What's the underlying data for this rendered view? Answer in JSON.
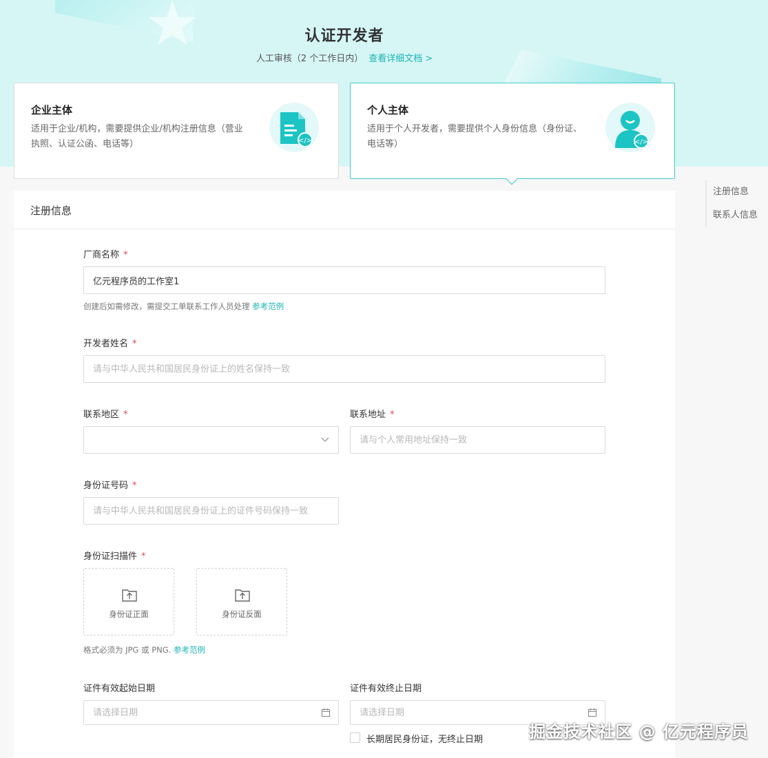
{
  "header": {
    "title": "认证开发者",
    "subtitle": "人工审核（2 个工作日内）",
    "doc_link": "查看详细文档",
    "chevron": ">"
  },
  "cards": [
    {
      "title": "企业主体",
      "desc": "适用于企业/机构，需要提供企业/机构注册信息（营业执照、认证公函、电话等）",
      "icon": "document-code-icon",
      "selected": false
    },
    {
      "title": "个人主体",
      "desc": "适用于个人开发者，需要提供个人身份信息（身份证、电话等）",
      "icon": "person-code-icon",
      "selected": true
    }
  ],
  "section": {
    "title": "注册信息"
  },
  "form": {
    "vendor_name": {
      "label": "厂商名称",
      "value": "亿元程序员的工作室1",
      "hint": "创建后如需修改，需提交工单联系工作人员处理",
      "hint_link": "参考范例"
    },
    "developer_name": {
      "label": "开发者姓名",
      "placeholder": "请与中华人民共和国居民身份证上的姓名保持一致"
    },
    "region": {
      "label": "联系地区",
      "value": ""
    },
    "address": {
      "label": "联系地址",
      "placeholder": "请与个人常用地址保持一致"
    },
    "id_number": {
      "label": "身份证号码",
      "placeholder": "请与中华人民共和国居民身份证上的证件号码保持一致"
    },
    "id_scan": {
      "label": "身份证扫描件",
      "front": "身份证正面",
      "back": "身份证反面",
      "hint": "格式必须为 JPG 或 PNG.",
      "hint_link": "参考范例"
    },
    "valid_start": {
      "label": "证件有效起始日期",
      "placeholder": "请选择日期"
    },
    "valid_end": {
      "label": "证件有效终止日期",
      "placeholder": "请选择日期"
    },
    "long_term": {
      "label": "长期居民身份证，无终止日期",
      "checked": false
    },
    "required_mark": "*"
  },
  "anchor_nav": [
    "注册信息",
    "联系人信息"
  ],
  "watermark": "掘金技术社区 @ 亿元程序员",
  "colors": {
    "accent": "#1db3b3",
    "header_bg": "#d6f6f6",
    "required": "#e5484d"
  }
}
